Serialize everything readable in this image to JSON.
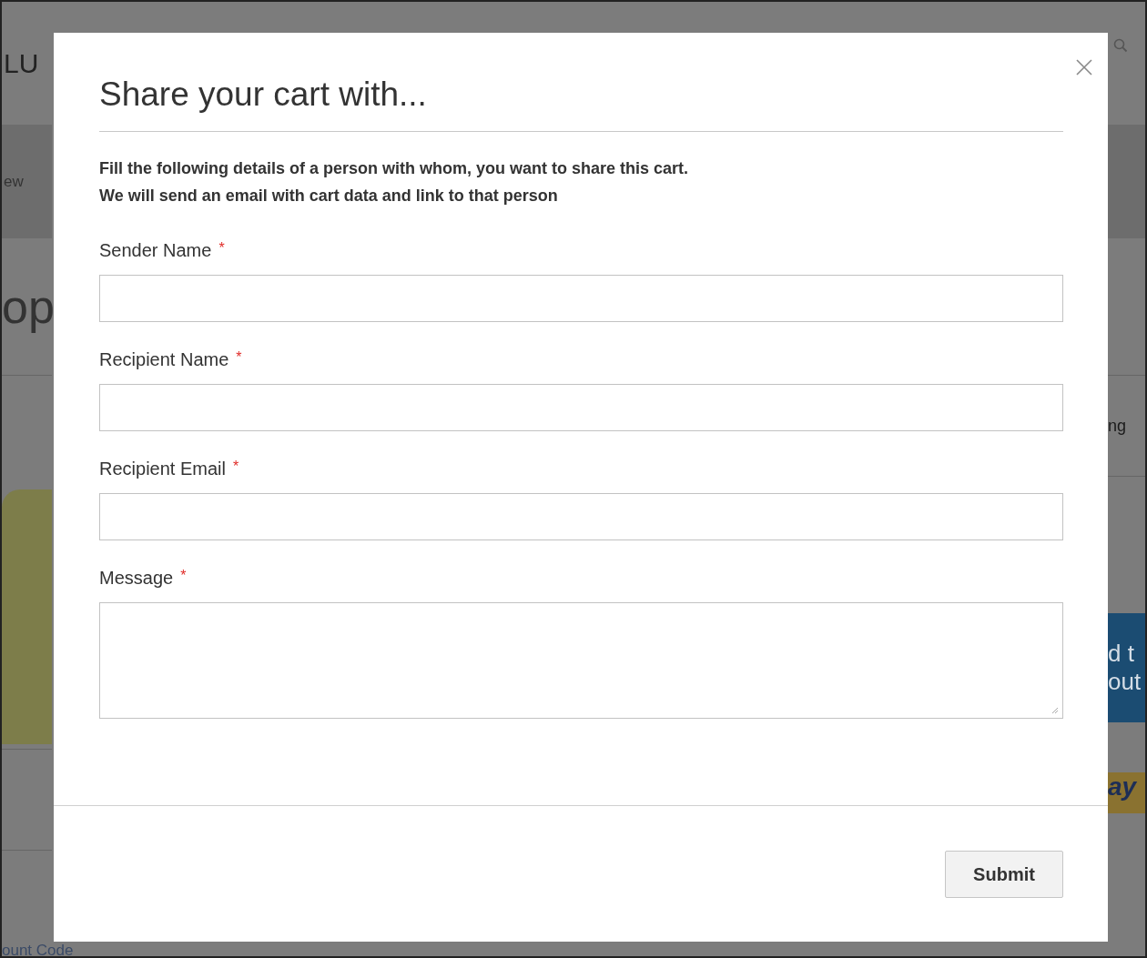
{
  "background": {
    "logo": "LU",
    "nav": "ew",
    "heading": "op",
    "column_text": "ng",
    "checkout_button": [
      "d t",
      "out"
    ],
    "paypal": "ay",
    "discount_link": "ount Code"
  },
  "modal": {
    "title": "Share your cart with...",
    "intro": [
      "Fill the following details of a person with whom, you want to share this cart.",
      "We will send an email with cart data and link to that person"
    ],
    "fields": [
      {
        "label": "Sender Name",
        "marker": "*",
        "kind": "input"
      },
      {
        "label": "Recipient Name",
        "marker": "*",
        "kind": "input"
      },
      {
        "label": "Recipient Email",
        "marker": "*",
        "kind": "input"
      },
      {
        "label": "Message",
        "marker": "*",
        "kind": "textarea"
      }
    ],
    "submit": "Submit"
  }
}
